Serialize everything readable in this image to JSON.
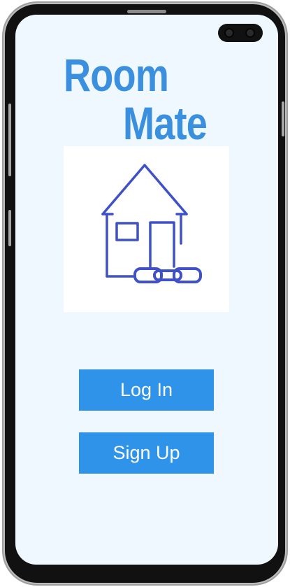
{
  "app": {
    "title_line1": "Room",
    "title_line2": "Mate"
  },
  "logo": {
    "icon": "house-with-chain-icon",
    "stroke_color": "#3f51c9"
  },
  "actions": {
    "login_label": "Log In",
    "signup_label": "Sign Up"
  },
  "colors": {
    "accent": "#2f93ea",
    "title": "#3a8fdf",
    "screen_background": "#f0f8ff"
  }
}
